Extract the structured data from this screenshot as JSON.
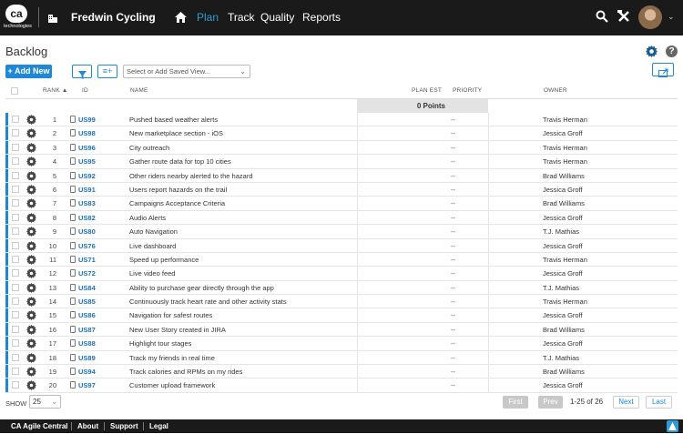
{
  "topbar": {
    "logo_text": "ca",
    "logo_subtext": "technologies",
    "workspace": "Fredwin Cycling",
    "nav": [
      {
        "label": "Plan",
        "active": true
      },
      {
        "label": "Track",
        "active": false
      },
      {
        "label": "Quality",
        "active": false
      },
      {
        "label": "Reports",
        "active": false
      }
    ],
    "icons": [
      "search-icon",
      "tools-icon",
      "avatar",
      "chevron-down-icon"
    ]
  },
  "page": {
    "title": "Backlog"
  },
  "toolbar": {
    "add_label": "+ Add New",
    "columns_label": "≡+",
    "saved_view_placeholder": "Select or Add Saved View..."
  },
  "table": {
    "headers": {
      "rank": "RANK ▲",
      "id": "ID",
      "name": "NAME",
      "plan_est": "PLAN EST",
      "priority": "PRIORITY",
      "owner": "OWNER"
    },
    "points_total": "0 Points",
    "rows": [
      {
        "rank": "1",
        "id": "US99",
        "name": "Pushed based weather alerts",
        "priority": "--",
        "owner": "Travis Herman"
      },
      {
        "rank": "2",
        "id": "US98",
        "name": "New marketplace section - iOS",
        "priority": "--",
        "owner": "Jessica Groff"
      },
      {
        "rank": "3",
        "id": "US96",
        "name": "City outreach",
        "priority": "--",
        "owner": "Travis Herman"
      },
      {
        "rank": "4",
        "id": "US95",
        "name": "Gather route data for top 10 cities",
        "priority": "--",
        "owner": "Travis Herman"
      },
      {
        "rank": "5",
        "id": "US92",
        "name": "Other riders nearby alerted to the hazard",
        "priority": "--",
        "owner": "Brad Williams"
      },
      {
        "rank": "6",
        "id": "US91",
        "name": "Users report hazards on the trail",
        "priority": "--",
        "owner": "Jessica Groff"
      },
      {
        "rank": "7",
        "id": "US83",
        "name": "Campaigns Acceptance Criteria",
        "priority": "--",
        "owner": "Brad Williams"
      },
      {
        "rank": "8",
        "id": "US82",
        "name": "Audio Alerts",
        "priority": "--",
        "owner": "Jessica Groff"
      },
      {
        "rank": "9",
        "id": "US80",
        "name": "Auto Navigation",
        "priority": "--",
        "owner": "T.J. Mathias"
      },
      {
        "rank": "10",
        "id": "US76",
        "name": "Live dashboard",
        "priority": "--",
        "owner": "Jessica Groff"
      },
      {
        "rank": "11",
        "id": "US71",
        "name": "Speed up performance",
        "priority": "--",
        "owner": "Travis Herman"
      },
      {
        "rank": "12",
        "id": "US72",
        "name": "Live video feed",
        "priority": "--",
        "owner": "Jessica Groff"
      },
      {
        "rank": "13",
        "id": "US84",
        "name": "Ability to purchase gear directly through the app",
        "priority": "--",
        "owner": "T.J. Mathias"
      },
      {
        "rank": "14",
        "id": "US85",
        "name": "Continuously track heart rate and other activity stats",
        "priority": "--",
        "owner": "Travis Herman"
      },
      {
        "rank": "15",
        "id": "US86",
        "name": "Navigation for safest routes",
        "priority": "--",
        "owner": "Jessica Groff"
      },
      {
        "rank": "16",
        "id": "US87",
        "name": "New User Story created in JIRA",
        "priority": "--",
        "owner": "Brad Williams"
      },
      {
        "rank": "17",
        "id": "US88",
        "name": "Highlight tour stages",
        "priority": "--",
        "owner": "Jessica Groff"
      },
      {
        "rank": "18",
        "id": "US89",
        "name": "Track my friends in real time",
        "priority": "--",
        "owner": "T.J. Mathias"
      },
      {
        "rank": "19",
        "id": "US94",
        "name": "Track calories and RPMs on my rides",
        "priority": "--",
        "owner": "Brad Williams"
      },
      {
        "rank": "20",
        "id": "US97",
        "name": "Customer upload framework",
        "priority": "--",
        "owner": "Jessica Groff"
      }
    ]
  },
  "pagination": {
    "show_label": "SHOW",
    "page_size": "25",
    "first": "First",
    "prev": "Prev",
    "range": "1-25 of 26",
    "next": "Next",
    "last": "Last"
  },
  "footer": {
    "brand": "CA Agile Central",
    "links": [
      "About",
      "Support",
      "Legal"
    ]
  },
  "colors": {
    "accent": "#1e88d5",
    "active_nav": "#2e9bd6",
    "topbar": "#1a1a1a"
  }
}
